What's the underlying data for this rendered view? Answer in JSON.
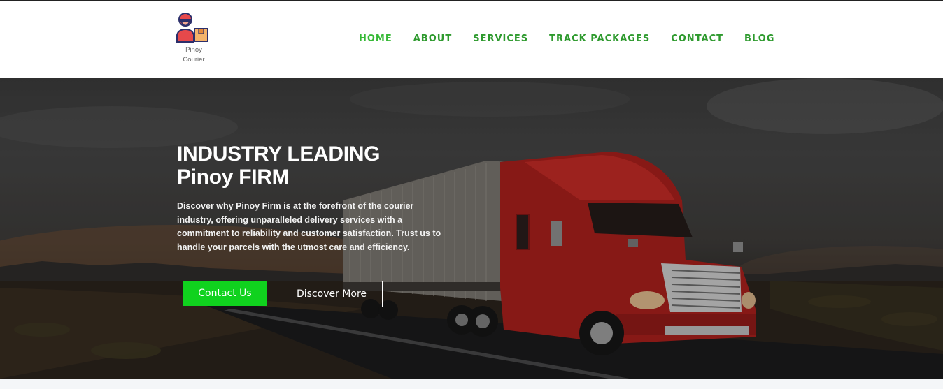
{
  "brand": {
    "name_line1": "Pinoy",
    "name_line2": "Courier"
  },
  "nav": {
    "items": [
      {
        "label": "HOME",
        "active": true
      },
      {
        "label": "ABOUT",
        "active": false
      },
      {
        "label": "SERVICES",
        "active": false
      },
      {
        "label": "TRACK PACKAGES",
        "active": false
      },
      {
        "label": "CONTACT",
        "active": false
      },
      {
        "label": "BLOG",
        "active": false
      }
    ]
  },
  "hero": {
    "title_line1": "INDUSTRY LEADING",
    "title_line2": "Pinoy FIRM",
    "description": "Discover why Pinoy Firm is at the forefront of the courier industry, offering unparalleled delivery services with a commitment to reliability and customer satisfaction. Trust us to handle your parcels with the utmost care and efficiency.",
    "primary_button": "Contact Us",
    "secondary_button": "Discover More"
  },
  "colors": {
    "nav_text": "#2e9a2e",
    "primary_button": "#10d21e",
    "truck_red": "#b3221e"
  },
  "icons": {
    "logo": "courier-with-package-icon"
  }
}
